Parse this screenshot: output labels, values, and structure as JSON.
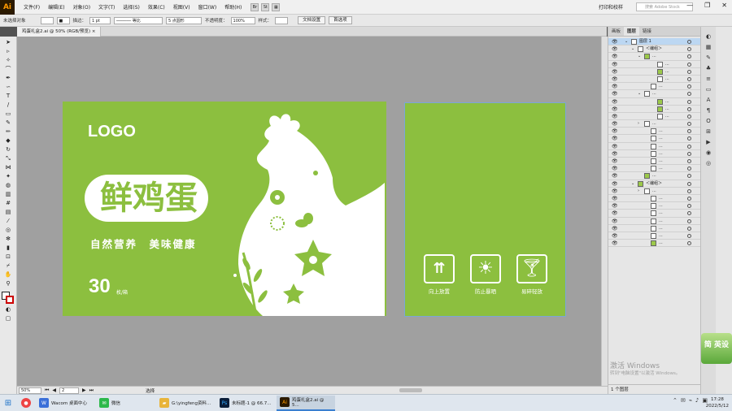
{
  "app": {
    "logo": "Ai",
    "menus": [
      "文件(F)",
      "编辑(E)",
      "对象(O)",
      "文字(T)",
      "选择(S)",
      "效果(C)",
      "视图(V)",
      "窗口(W)",
      "帮助(H)"
    ],
    "tool_btns": [
      "Br",
      "St"
    ],
    "workspace": "打印和校样",
    "search_placeholder": "搜索 Adobe Stock",
    "win_min": "—",
    "win_max": "❐",
    "win_close": "✕"
  },
  "control": {
    "selection": "未选择对象",
    "stroke_label": "描边：",
    "stroke_value": "1 pt",
    "uniform": "等比",
    "brush": "5 点圆形",
    "opacity_label": "不透明度：",
    "opacity_value": "100%",
    "style_label": "样式：",
    "doc_setup": "文档设置",
    "prefs": "首选项"
  },
  "document": {
    "tab": "鸡蛋礼盒2.ai @ 50% (RGB/预览)",
    "close": "×"
  },
  "art1": {
    "logo": "LOGO",
    "title_chars": [
      "鲜",
      "鸡",
      "蛋"
    ],
    "slogan": "自然营养　美味健康",
    "count": "30",
    "count_unit": "枚/箱"
  },
  "art2": {
    "icons": [
      {
        "label": "向上放置",
        "icon": "arrows-up-icon"
      },
      {
        "label": "防止暴晒",
        "icon": "sun-icon"
      },
      {
        "label": "易碎轻放",
        "icon": "glass-icon"
      }
    ]
  },
  "colors": {
    "artboard_green": "#8cbf3f",
    "white": "#ffffff"
  },
  "status": {
    "zoom": "50%",
    "page": "2",
    "mode": "选择"
  },
  "panel": {
    "tabs": [
      "画板",
      "图层",
      "链接"
    ],
    "active_tab": "图层",
    "layer1": "图层 1",
    "group": "＜编组＞",
    "ellipsis": "...",
    "footer": "1 个图层"
  },
  "activation": {
    "title": "激活 Windows",
    "subtitle": "转到\"电脑设置\"以激活 Windows。"
  },
  "ime": {
    "text": "简 英设"
  },
  "taskbar": {
    "items": [
      {
        "label": "",
        "icon": "chrome-icon"
      },
      {
        "label": "Wacom 桌面中心",
        "icon": "wacom-icon"
      },
      {
        "label": "微信",
        "icon": "wechat-icon"
      },
      {
        "label": "G:\\yingfeng资料...",
        "icon": "folder-icon"
      },
      {
        "label": "未标题-1 @ 66.7...",
        "icon": "photoshop-icon"
      },
      {
        "label": "鸡蛋礼盒2.ai @ 5...",
        "icon": "illustrator-icon"
      }
    ],
    "time": "17:28",
    "date": "2022/5/12"
  }
}
